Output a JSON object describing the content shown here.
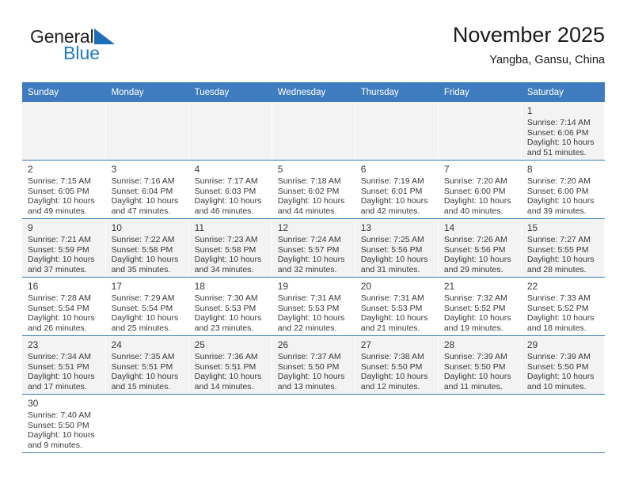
{
  "brand": {
    "name_top": "General",
    "name_bottom": "Blue",
    "triangle_color": "#1d6fb8",
    "bottom_color": "#1d7cc4"
  },
  "header": {
    "title": "November 2025",
    "location": "Yangba, Gansu, China"
  },
  "theme": {
    "header_blue": "#3e7cbf",
    "row_shaded": "#f3f3f3",
    "row_plain": "#ffffff",
    "text": "#3a3a3a"
  },
  "weekdays": [
    "Sunday",
    "Monday",
    "Tuesday",
    "Wednesday",
    "Thursday",
    "Friday",
    "Saturday"
  ],
  "weeks": [
    [
      {
        "empty": true
      },
      {
        "empty": true
      },
      {
        "empty": true
      },
      {
        "empty": true
      },
      {
        "empty": true
      },
      {
        "empty": true
      },
      {
        "day": "1",
        "sunrise": "Sunrise: 7:14 AM",
        "sunset": "Sunset: 6:06 PM",
        "daylight1": "Daylight: 10 hours",
        "daylight2": "and 51 minutes."
      }
    ],
    [
      {
        "day": "2",
        "sunrise": "Sunrise: 7:15 AM",
        "sunset": "Sunset: 6:05 PM",
        "daylight1": "Daylight: 10 hours",
        "daylight2": "and 49 minutes."
      },
      {
        "day": "3",
        "sunrise": "Sunrise: 7:16 AM",
        "sunset": "Sunset: 6:04 PM",
        "daylight1": "Daylight: 10 hours",
        "daylight2": "and 47 minutes."
      },
      {
        "day": "4",
        "sunrise": "Sunrise: 7:17 AM",
        "sunset": "Sunset: 6:03 PM",
        "daylight1": "Daylight: 10 hours",
        "daylight2": "and 46 minutes."
      },
      {
        "day": "5",
        "sunrise": "Sunrise: 7:18 AM",
        "sunset": "Sunset: 6:02 PM",
        "daylight1": "Daylight: 10 hours",
        "daylight2": "and 44 minutes."
      },
      {
        "day": "6",
        "sunrise": "Sunrise: 7:19 AM",
        "sunset": "Sunset: 6:01 PM",
        "daylight1": "Daylight: 10 hours",
        "daylight2": "and 42 minutes."
      },
      {
        "day": "7",
        "sunrise": "Sunrise: 7:20 AM",
        "sunset": "Sunset: 6:00 PM",
        "daylight1": "Daylight: 10 hours",
        "daylight2": "and 40 minutes."
      },
      {
        "day": "8",
        "sunrise": "Sunrise: 7:20 AM",
        "sunset": "Sunset: 6:00 PM",
        "daylight1": "Daylight: 10 hours",
        "daylight2": "and 39 minutes."
      }
    ],
    [
      {
        "day": "9",
        "sunrise": "Sunrise: 7:21 AM",
        "sunset": "Sunset: 5:59 PM",
        "daylight1": "Daylight: 10 hours",
        "daylight2": "and 37 minutes."
      },
      {
        "day": "10",
        "sunrise": "Sunrise: 7:22 AM",
        "sunset": "Sunset: 5:58 PM",
        "daylight1": "Daylight: 10 hours",
        "daylight2": "and 35 minutes."
      },
      {
        "day": "11",
        "sunrise": "Sunrise: 7:23 AM",
        "sunset": "Sunset: 5:58 PM",
        "daylight1": "Daylight: 10 hours",
        "daylight2": "and 34 minutes."
      },
      {
        "day": "12",
        "sunrise": "Sunrise: 7:24 AM",
        "sunset": "Sunset: 5:57 PM",
        "daylight1": "Daylight: 10 hours",
        "daylight2": "and 32 minutes."
      },
      {
        "day": "13",
        "sunrise": "Sunrise: 7:25 AM",
        "sunset": "Sunset: 5:56 PM",
        "daylight1": "Daylight: 10 hours",
        "daylight2": "and 31 minutes."
      },
      {
        "day": "14",
        "sunrise": "Sunrise: 7:26 AM",
        "sunset": "Sunset: 5:56 PM",
        "daylight1": "Daylight: 10 hours",
        "daylight2": "and 29 minutes."
      },
      {
        "day": "15",
        "sunrise": "Sunrise: 7:27 AM",
        "sunset": "Sunset: 5:55 PM",
        "daylight1": "Daylight: 10 hours",
        "daylight2": "and 28 minutes."
      }
    ],
    [
      {
        "day": "16",
        "sunrise": "Sunrise: 7:28 AM",
        "sunset": "Sunset: 5:54 PM",
        "daylight1": "Daylight: 10 hours",
        "daylight2": "and 26 minutes."
      },
      {
        "day": "17",
        "sunrise": "Sunrise: 7:29 AM",
        "sunset": "Sunset: 5:54 PM",
        "daylight1": "Daylight: 10 hours",
        "daylight2": "and 25 minutes."
      },
      {
        "day": "18",
        "sunrise": "Sunrise: 7:30 AM",
        "sunset": "Sunset: 5:53 PM",
        "daylight1": "Daylight: 10 hours",
        "daylight2": "and 23 minutes."
      },
      {
        "day": "19",
        "sunrise": "Sunrise: 7:31 AM",
        "sunset": "Sunset: 5:53 PM",
        "daylight1": "Daylight: 10 hours",
        "daylight2": "and 22 minutes."
      },
      {
        "day": "20",
        "sunrise": "Sunrise: 7:31 AM",
        "sunset": "Sunset: 5:53 PM",
        "daylight1": "Daylight: 10 hours",
        "daylight2": "and 21 minutes."
      },
      {
        "day": "21",
        "sunrise": "Sunrise: 7:32 AM",
        "sunset": "Sunset: 5:52 PM",
        "daylight1": "Daylight: 10 hours",
        "daylight2": "and 19 minutes."
      },
      {
        "day": "22",
        "sunrise": "Sunrise: 7:33 AM",
        "sunset": "Sunset: 5:52 PM",
        "daylight1": "Daylight: 10 hours",
        "daylight2": "and 18 minutes."
      }
    ],
    [
      {
        "day": "23",
        "sunrise": "Sunrise: 7:34 AM",
        "sunset": "Sunset: 5:51 PM",
        "daylight1": "Daylight: 10 hours",
        "daylight2": "and 17 minutes."
      },
      {
        "day": "24",
        "sunrise": "Sunrise: 7:35 AM",
        "sunset": "Sunset: 5:51 PM",
        "daylight1": "Daylight: 10 hours",
        "daylight2": "and 15 minutes."
      },
      {
        "day": "25",
        "sunrise": "Sunrise: 7:36 AM",
        "sunset": "Sunset: 5:51 PM",
        "daylight1": "Daylight: 10 hours",
        "daylight2": "and 14 minutes."
      },
      {
        "day": "26",
        "sunrise": "Sunrise: 7:37 AM",
        "sunset": "Sunset: 5:50 PM",
        "daylight1": "Daylight: 10 hours",
        "daylight2": "and 13 minutes."
      },
      {
        "day": "27",
        "sunrise": "Sunrise: 7:38 AM",
        "sunset": "Sunset: 5:50 PM",
        "daylight1": "Daylight: 10 hours",
        "daylight2": "and 12 minutes."
      },
      {
        "day": "28",
        "sunrise": "Sunrise: 7:39 AM",
        "sunset": "Sunset: 5:50 PM",
        "daylight1": "Daylight: 10 hours",
        "daylight2": "and 11 minutes."
      },
      {
        "day": "29",
        "sunrise": "Sunrise: 7:39 AM",
        "sunset": "Sunset: 5:50 PM",
        "daylight1": "Daylight: 10 hours",
        "daylight2": "and 10 minutes."
      }
    ],
    [
      {
        "day": "30",
        "sunrise": "Sunrise: 7:40 AM",
        "sunset": "Sunset: 5:50 PM",
        "daylight1": "Daylight: 10 hours",
        "daylight2": "and 9 minutes."
      },
      {
        "empty": true
      },
      {
        "empty": true
      },
      {
        "empty": true
      },
      {
        "empty": true
      },
      {
        "empty": true
      },
      {
        "empty": true
      }
    ]
  ]
}
